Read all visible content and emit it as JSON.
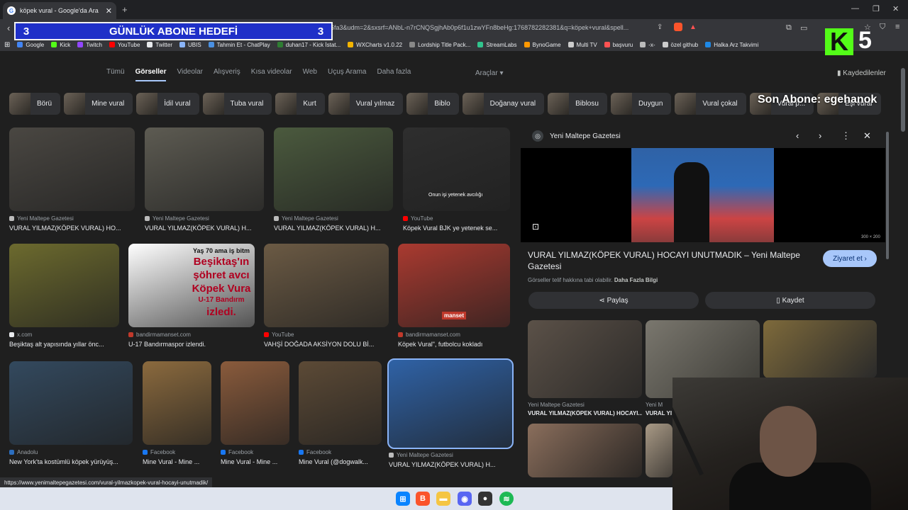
{
  "browser": {
    "tab_title": "köpek vural - Google'da Ara",
    "url": "6fa3&udm=2&sxsrf=ANbL-n7rCNQSgjhAb0p6f1u1zwYFn8beHg:1768782282381&q=köpek+vural&spell...",
    "bookmarks": [
      "Google",
      "Kick",
      "Twitch",
      "YouTube",
      "Twitter",
      "UBIS",
      "Tahmin Et - ChatPlay",
      "duhan17 - Kick İstat...",
      "WXCharts v1.0.22",
      "Lordship Title Pack...",
      "StreamLabs",
      "BynoGame",
      "Multi TV",
      "başvuru",
      "-x-",
      "özel github",
      "Halka Arz Takvimi"
    ],
    "bookmark_colors": [
      "#4285f4",
      "#53fc18",
      "#9146ff",
      "#ff0000",
      "#e8eaed",
      "#8ab4f8",
      "#4a90e2",
      "#2e7d32",
      "#f4b400",
      "#888888",
      "#31c48d",
      "#ff9800",
      "#cccccc",
      "#ff5252",
      "#bbbbbb",
      "#cccccc",
      "#1e88e5"
    ]
  },
  "overlay": {
    "goal_left": "3",
    "goal_text": "GÜNLÜK ABONE HEDEFİ",
    "goal_right": "3",
    "kick_count": "5",
    "last_sub": "Son Abone: egehanok"
  },
  "google_nav": {
    "tabs": [
      "Tümü",
      "Görseller",
      "Videolar",
      "Alışveriş",
      "Kısa videolar",
      "Web",
      "Uçuş Arama",
      "Daha fazla"
    ],
    "active": "Görseller",
    "tools": "Araçlar",
    "saved": "Kaydedilenler"
  },
  "chips": [
    "Börü",
    "Mine vural",
    "İdil vural",
    "Tuba vural",
    "Kurt",
    "Vural yılmaz",
    "Biblo",
    "Doğanay vural",
    "Biblosu",
    "Duygun",
    "Vural çokal",
    "Vural p...",
    "Eşi vural"
  ],
  "results": [
    {
      "source": "Yeni Maltepe Gazetesi",
      "title": "VURAL YILMAZ(KÖPEK VURAL) HO...",
      "color": "#4a4742"
    },
    {
      "source": "Yeni Maltepe Gazetesi",
      "title": "VURAL YILMAZ(KÖPEK VURAL) H...",
      "color": "#5d5b52"
    },
    {
      "source": "Yeni Maltepe Gazetesi",
      "title": "VURAL YILMAZ(KÖPEK VURAL) H...",
      "color": "#4b5a3e"
    },
    {
      "source": "YouTube",
      "title": "Köpek Vural BJK ye yetenek se...",
      "color": "#2e2e2e",
      "caption": "Onun işi yetenek avcılığı"
    },
    {
      "source": "x.com",
      "title": "Beşiktaş alt yapısında yıllar önc...",
      "color": "#6c6a2e"
    },
    {
      "source": "bandirmamanset.com",
      "title": "U-17 Bandırmaspor izlendi.",
      "color": "#ffffff"
    },
    {
      "source": "YouTube",
      "title": "VAHŞİ DOĞADA AKSİYON DOLU Bİ...",
      "color": "#6b5a44"
    },
    {
      "source": "bandirmamanset.com",
      "title": "Köpek Vural\", futbolcu kokladı",
      "color": "#aa3a30"
    },
    {
      "source": "Anadolu",
      "title": "New York'ta kostümlü köpek yürüyüş...",
      "color": "#33495e"
    },
    {
      "source": "Facebook",
      "title": "Mine Vural - Mine ...",
      "color": "#8b6a3e"
    },
    {
      "source": "Facebook",
      "title": "Mine Vural - Mine ...",
      "color": "#8a5b3c"
    },
    {
      "source": "Facebook",
      "title": "Mine Vural (@dogwalk...",
      "color": "#5c4a36"
    },
    {
      "source": "Yeni Maltepe Gazetesi",
      "title": "VURAL YILMAZ(KÖPEK VURAL) H...",
      "color": "#2f62a6"
    }
  ],
  "thumbnail_text": {
    "line1": "Yaş 70 ama iş bitm",
    "line2": "Beşiktaş'ın",
    "line3": "şöhret avcı",
    "line4": "Köpek Vura",
    "line5": "U-17 Bandırm",
    "line6": "izledi.",
    "manset": "manset"
  },
  "panel": {
    "source": "Yeni Maltepe Gazetesi",
    "dimensions": "300 × 200",
    "title": "VURAL YILMAZ(KÖPEK VURAL) HOCAYI UNUTMADIK – Yeni Maltepe Gazetesi",
    "visit": "Ziyaret et",
    "copyright": "Görseller telif hakkına tabi olabilir.",
    "more_info": "Daha Fazla Bilgi",
    "share": "Paylaş",
    "save": "Kaydet",
    "related": [
      {
        "source": "Yeni Maltepe Gazetesi",
        "title": "VURAL YILMAZ(KÖPEK VURAL) HOCAYI..."
      },
      {
        "source": "Yeni M",
        "title": "VURAL YI"
      }
    ]
  },
  "status_url": "https://www.yenimaltepegazetesi.com/vural-yilmazkopek-vural-hocayi-unutmadik/"
}
